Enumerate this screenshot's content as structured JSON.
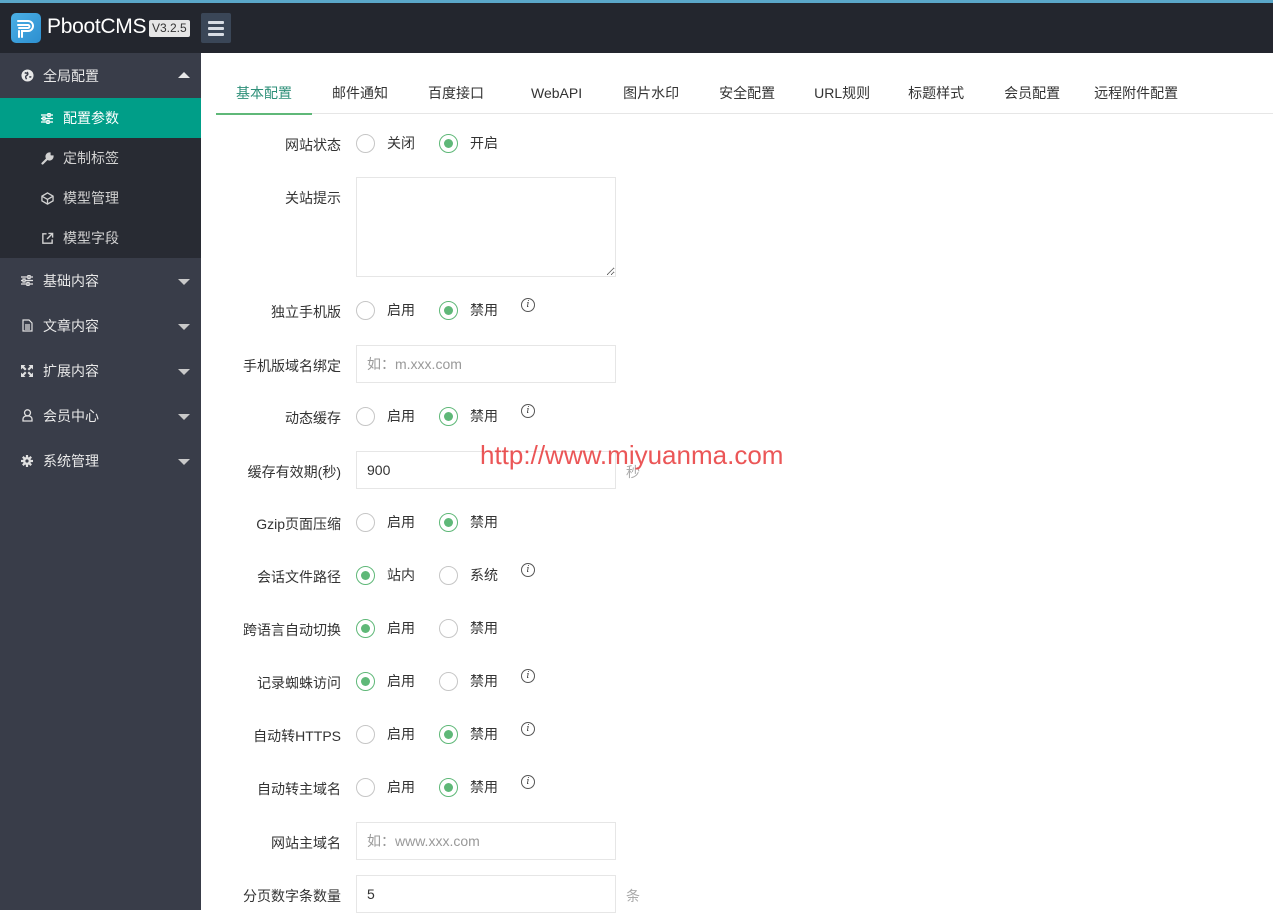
{
  "header": {
    "brand": "PbootCMS",
    "version": "V3.2.5",
    "menu_toggle_icon": "hamburger-icon"
  },
  "sidebar": {
    "groups": [
      {
        "label": "全局配置",
        "icon": "globe-icon",
        "expanded": true,
        "items": [
          {
            "label": "配置参数",
            "icon": "sliders-icon",
            "active": true
          },
          {
            "label": "定制标签",
            "icon": "wrench-icon",
            "active": false
          },
          {
            "label": "模型管理",
            "icon": "cube-icon",
            "active": false
          },
          {
            "label": "模型字段",
            "icon": "external-link-icon",
            "active": false
          }
        ]
      },
      {
        "label": "基础内容",
        "icon": "sliders-icon",
        "expanded": false
      },
      {
        "label": "文章内容",
        "icon": "document-icon",
        "expanded": false
      },
      {
        "label": "扩展内容",
        "icon": "expand-icon",
        "expanded": false
      },
      {
        "label": "会员中心",
        "icon": "user-icon",
        "expanded": false
      },
      {
        "label": "系统管理",
        "icon": "gear-icon",
        "expanded": false
      }
    ]
  },
  "tabs": [
    {
      "label": "基本配置",
      "active": true
    },
    {
      "label": "邮件通知",
      "active": false
    },
    {
      "label": "百度接口",
      "active": false
    },
    {
      "label": "WebAPI",
      "active": false
    },
    {
      "label": "图片水印",
      "active": false
    },
    {
      "label": "安全配置",
      "active": false
    },
    {
      "label": "URL规则",
      "active": false
    },
    {
      "label": "标题样式",
      "active": false
    },
    {
      "label": "会员配置",
      "active": false
    },
    {
      "label": "远程附件配置",
      "active": false
    }
  ],
  "form": {
    "site_status": {
      "label": "网站状态",
      "options": [
        "关闭",
        "开启"
      ],
      "selected": "开启"
    },
    "close_tip": {
      "label": "关站提示",
      "value": ""
    },
    "mobile_site": {
      "label": "独立手机版",
      "options": [
        "启用",
        "禁用"
      ],
      "selected": "禁用",
      "info": true
    },
    "mobile_domain": {
      "label": "手机版域名绑定",
      "placeholder": "如：m.xxx.com",
      "value": ""
    },
    "dynamic_cache": {
      "label": "动态缓存",
      "options": [
        "启用",
        "禁用"
      ],
      "selected": "禁用",
      "info": true
    },
    "cache_ttl": {
      "label": "缓存有效期(秒)",
      "value": "900",
      "unit": "秒"
    },
    "gzip": {
      "label": "Gzip页面压缩",
      "options": [
        "启用",
        "禁用"
      ],
      "selected": "禁用"
    },
    "session_path": {
      "label": "会话文件路径",
      "options": [
        "站内",
        "系统"
      ],
      "selected": "站内",
      "info": true
    },
    "lang_switch": {
      "label": "跨语言自动切换",
      "options": [
        "启用",
        "禁用"
      ],
      "selected": "启用"
    },
    "spider_log": {
      "label": "记录蜘蛛访问",
      "options": [
        "启用",
        "禁用"
      ],
      "selected": "启用",
      "info": true
    },
    "auto_https": {
      "label": "自动转HTTPS",
      "options": [
        "启用",
        "禁用"
      ],
      "selected": "禁用",
      "info": true
    },
    "auto_main_domain": {
      "label": "自动转主域名",
      "options": [
        "启用",
        "禁用"
      ],
      "selected": "禁用",
      "info": true
    },
    "main_domain": {
      "label": "网站主域名",
      "placeholder": "如：www.xxx.com",
      "value": ""
    },
    "page_num_count": {
      "label": "分页数字条数量",
      "value": "5",
      "unit": "条"
    }
  },
  "watermark": "http://www.miyuanma.com",
  "colors": {
    "header_bg": "#23262e",
    "sidebar_bg": "#393d49",
    "active_item": "#009e88",
    "radio_accent": "#5fb878"
  }
}
